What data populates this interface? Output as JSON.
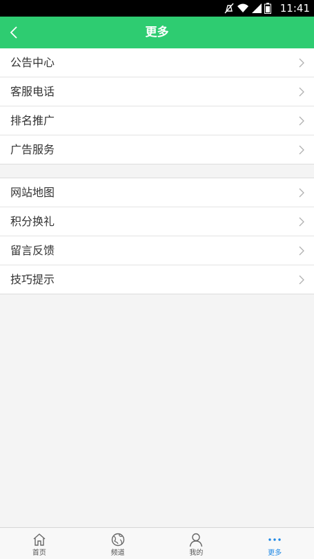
{
  "status_bar": {
    "time": "11:41",
    "icons": [
      "mute-icon",
      "wifi-icon",
      "signal-icon",
      "battery-icon"
    ]
  },
  "header": {
    "title": "更多",
    "back_icon": "chevron-left-icon",
    "background": "#2ecc71"
  },
  "groups": [
    {
      "items": [
        {
          "label": "公告中心"
        },
        {
          "label": "客服电话"
        },
        {
          "label": "排名推广"
        },
        {
          "label": "广告服务"
        }
      ]
    },
    {
      "items": [
        {
          "label": "网站地图"
        },
        {
          "label": "积分换礼"
        },
        {
          "label": "留言反馈"
        },
        {
          "label": "技巧提示"
        }
      ]
    }
  ],
  "tab_bar": {
    "active_color": "#1e88e5",
    "tabs": [
      {
        "label": "首页",
        "icon": "home-icon"
      },
      {
        "label": "频道",
        "icon": "globe-icon"
      },
      {
        "label": "我的",
        "icon": "user-icon"
      },
      {
        "label": "更多",
        "icon": "more-icon",
        "active": true
      }
    ]
  }
}
